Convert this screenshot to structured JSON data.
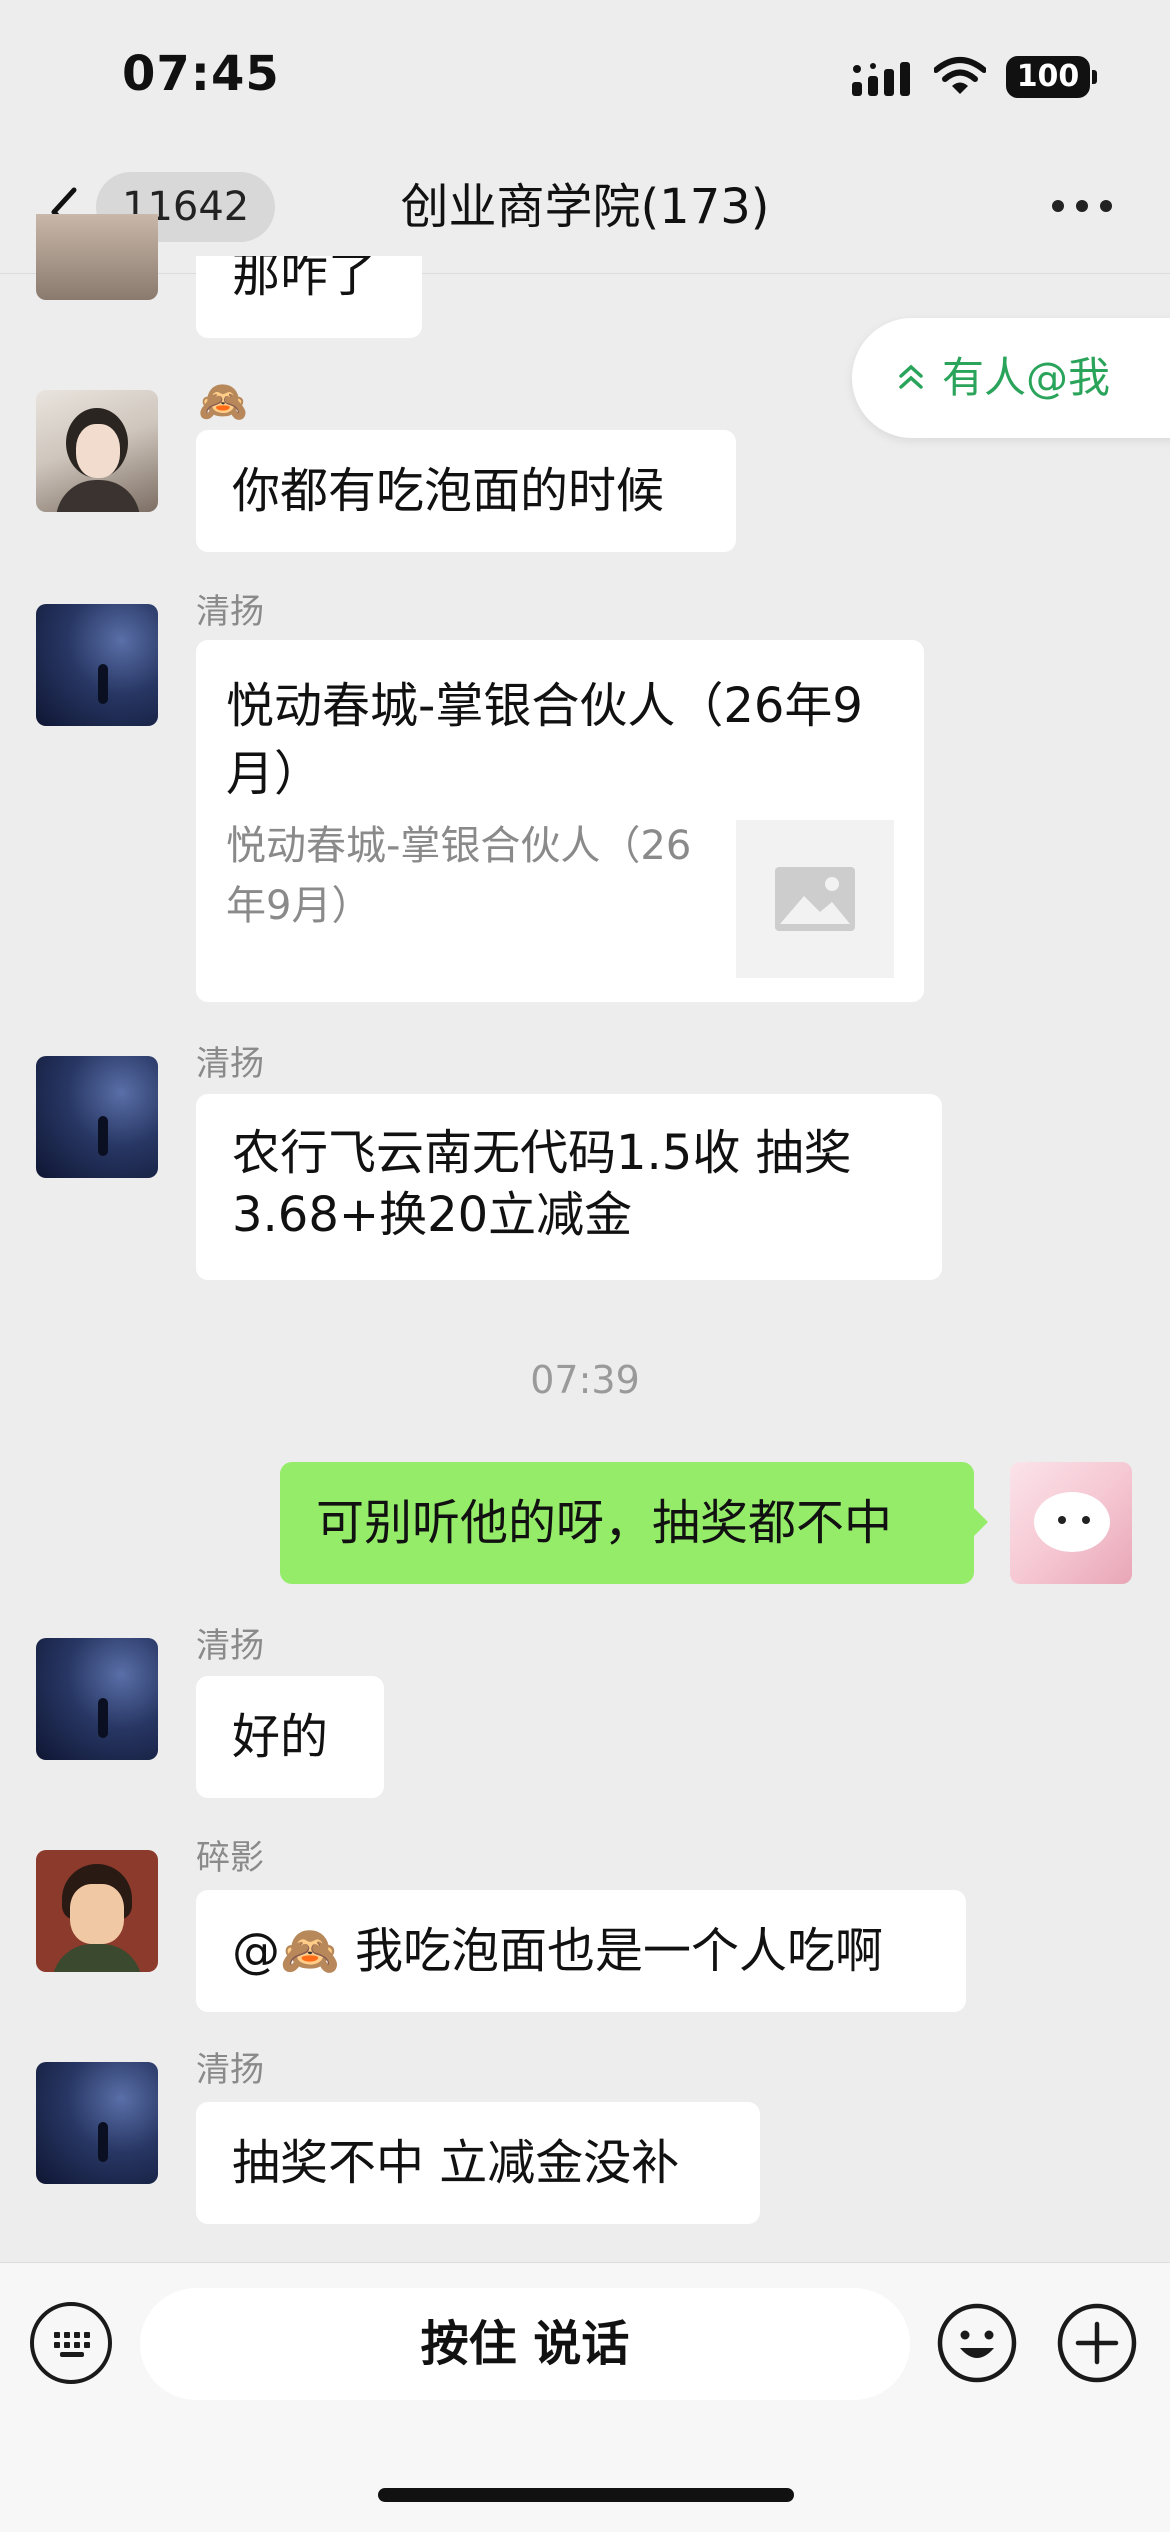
{
  "status_bar": {
    "time": "07:45",
    "battery": "100"
  },
  "nav": {
    "back_count": "11642",
    "title": "创业商学院(173)"
  },
  "at_me_label": "有人@我",
  "messages": {
    "partial_top": "那咋了",
    "m1": {
      "text": "你都有吃泡面的时候"
    },
    "m2": {
      "sender": "清扬",
      "card_title": "悦动春城-掌银合伙人（26年9月）",
      "card_desc": "悦动春城-掌银合伙人（26年9月）"
    },
    "m3": {
      "sender": "清扬",
      "text_line1": "农行飞云南无代码1.5收  抽奖",
      "text_line2": "3.68+换20立减金"
    },
    "time_divider": "07:39",
    "m4": {
      "text": "可别听他的呀，抽奖都不中"
    },
    "m5": {
      "sender": "清扬",
      "text": "好的"
    },
    "m6": {
      "sender": "碎影",
      "text_prefix": "@",
      "text": " 我吃泡面也是一个人吃啊"
    },
    "m7": {
      "sender": "清扬",
      "text": "抽奖不中  立减金没补"
    }
  },
  "input_bar": {
    "voice_label": "按住 说话"
  },
  "icons": {
    "back": "chevron-left-icon",
    "more": "more-horizontal-icon",
    "keyboard": "keyboard-icon",
    "emoji": "smiley-icon",
    "plus": "plus-circle-icon"
  },
  "colors": {
    "accent_green": "#95ec69",
    "link_green": "#2aa45a",
    "background": "#ededed"
  }
}
